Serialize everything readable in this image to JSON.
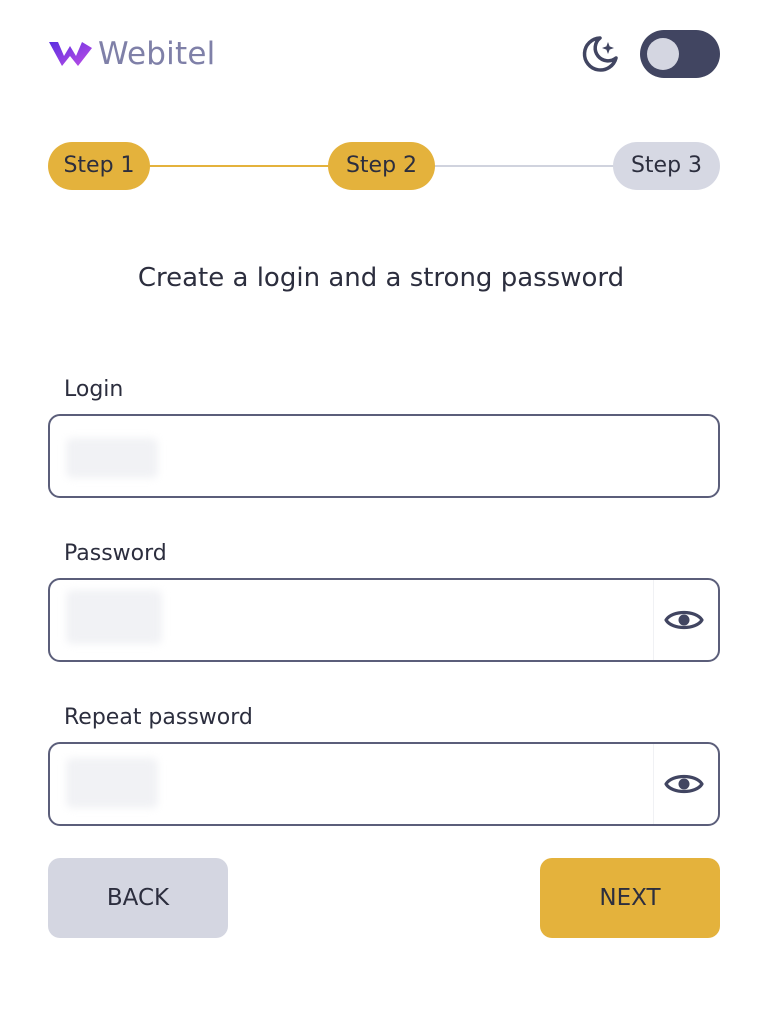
{
  "header": {
    "logo_text": "Webitel",
    "theme_icon": "moon-stars-icon",
    "toggle_state": "off"
  },
  "stepper": {
    "steps": [
      {
        "label": "Step 1",
        "state": "done"
      },
      {
        "label": "Step 2",
        "state": "current"
      },
      {
        "label": "Step 3",
        "state": "pending"
      }
    ]
  },
  "form": {
    "heading": "Create a login and a strong password",
    "login": {
      "label": "Login",
      "value": ""
    },
    "password": {
      "label": "Password",
      "value": "",
      "icon": "eye-icon"
    },
    "repeat_password": {
      "label": "Repeat password",
      "value": "",
      "icon": "eye-icon"
    }
  },
  "actions": {
    "back_label": "BACK",
    "next_label": "NEXT"
  },
  "colors": {
    "accent": "#e4b23c",
    "muted": "#d4d6e1",
    "toggle_bg": "#414561",
    "text": "#2c2e3e",
    "logo_text": "#7f80a8",
    "logo_mark": "#7a3df2"
  }
}
